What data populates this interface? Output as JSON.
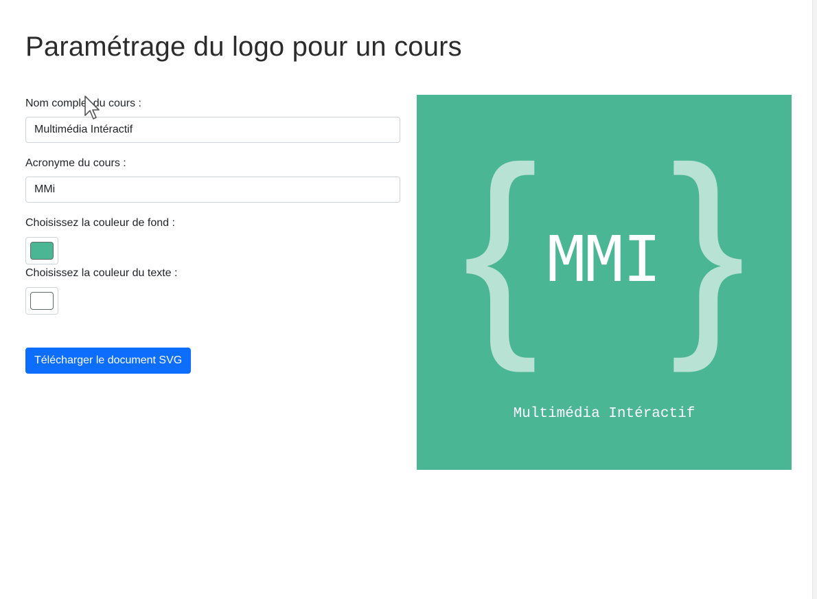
{
  "page": {
    "title": "Paramétrage du logo pour un cours"
  },
  "form": {
    "course_name": {
      "label": "Nom complet du cours :",
      "value": "Multimédia Intéractif"
    },
    "acronym": {
      "label": "Acronyme du cours :",
      "value": "MMi"
    },
    "background_color": {
      "label": "Choisissez la couleur de fond :",
      "value": "#4bb693"
    },
    "text_color": {
      "label": "Choisissez la couleur du texte :",
      "value": "#ffffff"
    },
    "download_button": {
      "label": "Télécharger le document SVG"
    }
  },
  "logo": {
    "background": "#4bb693",
    "text_color": "#ffffff",
    "bracket_color": "#b8e2d3",
    "acronym": "MMI",
    "open_brace": "{",
    "close_brace": "}",
    "subtitle": "Multimédia Intéractif"
  },
  "icons": {
    "cursor": "mouse-pointer-icon"
  }
}
